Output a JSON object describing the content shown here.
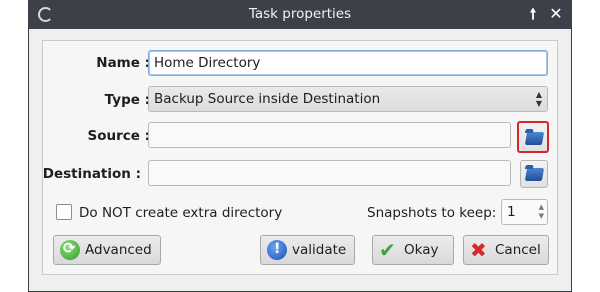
{
  "window": {
    "title": "Task properties",
    "controls": {
      "up": "🠕",
      "close": "✕"
    }
  },
  "form": {
    "name_label": "Name :",
    "name_value": "Home Directory",
    "type_label": "Type :",
    "type_value": "Backup Source inside Destination",
    "source_label": "Source :",
    "source_value": "",
    "destination_label": "Destination :",
    "destination_value": "",
    "no_extra_dir_label": "Do NOT create extra directory",
    "no_extra_dir_checked": false,
    "snapshots_label": "Snapshots to keep:",
    "snapshots_value": "1"
  },
  "buttons": {
    "advanced": "Advanced",
    "validate": "validate",
    "okay": "Okay",
    "cancel": "Cancel"
  },
  "icons": {
    "window_menu": "window-menu-icon",
    "browse": "folder-icon",
    "advanced": "refresh-icon",
    "validate": "info-icon",
    "okay": "check-icon",
    "cancel": "x-icon"
  },
  "colors": {
    "titlebar": "#3b4049",
    "highlight": "#d6262c",
    "focus": "#7fa9d8"
  }
}
